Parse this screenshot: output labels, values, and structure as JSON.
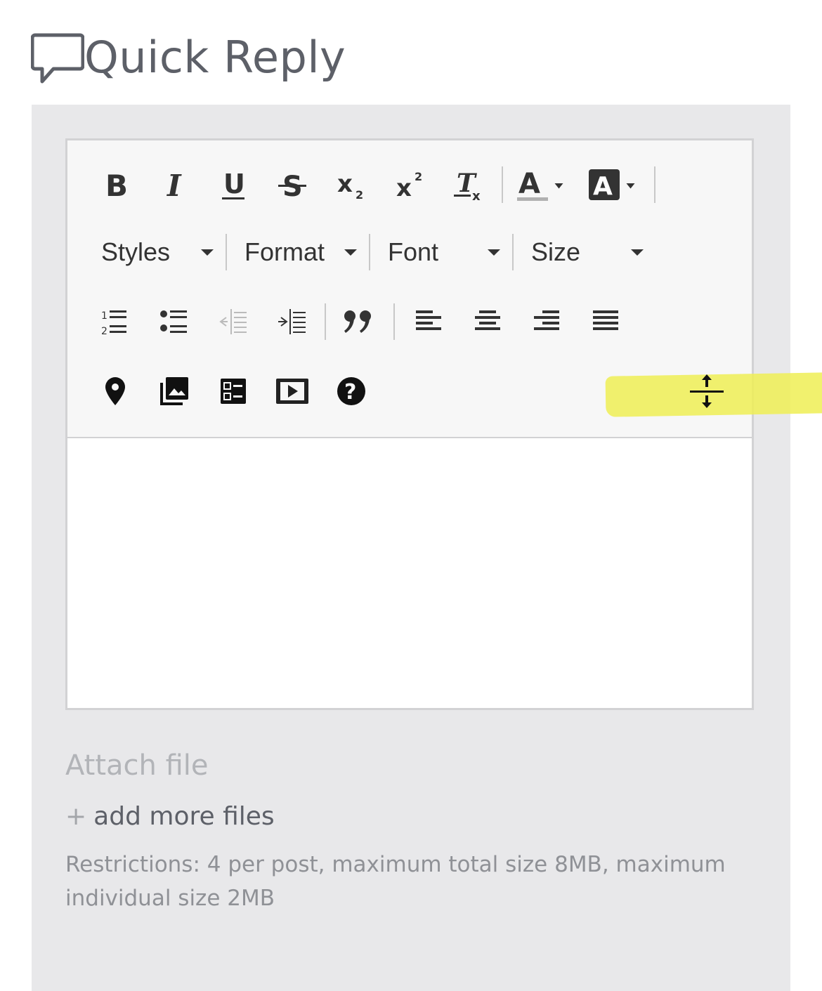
{
  "header": {
    "title": "Quick Reply",
    "icon": "speech-bubble-icon"
  },
  "toolbar": {
    "row1": [
      "bold-icon",
      "italic-icon",
      "underline-icon",
      "strikethrough-icon",
      "subscript-icon",
      "superscript-icon",
      "remove-format-icon",
      "text-color-icon",
      "background-color-icon"
    ],
    "row2": {
      "styles": "Styles",
      "format": "Format",
      "font": "Font",
      "size": "Size"
    },
    "row3": [
      "numbered-list-icon",
      "bulleted-list-icon",
      "decrease-indent-icon",
      "increase-indent-icon",
      "blockquote-icon",
      "align-left-icon",
      "align-center-icon",
      "align-right-icon",
      "justify-icon"
    ],
    "row4": [
      "map-pin-icon",
      "image-gallery-icon",
      "table-template-icon",
      "video-icon",
      "help-icon",
      "resize-vertical-icon"
    ]
  },
  "editor": {
    "content": ""
  },
  "attachments": {
    "label": "Attach file",
    "add_more": "add more files",
    "add_more_prefix": "+",
    "restrictions": "Restrictions: 4 per post, maximum total size 8MB, maximum individual size 2MB"
  },
  "colors": {
    "highlight": "#eeee55",
    "panel": "#e8e8ea",
    "title": "#5d6068"
  }
}
